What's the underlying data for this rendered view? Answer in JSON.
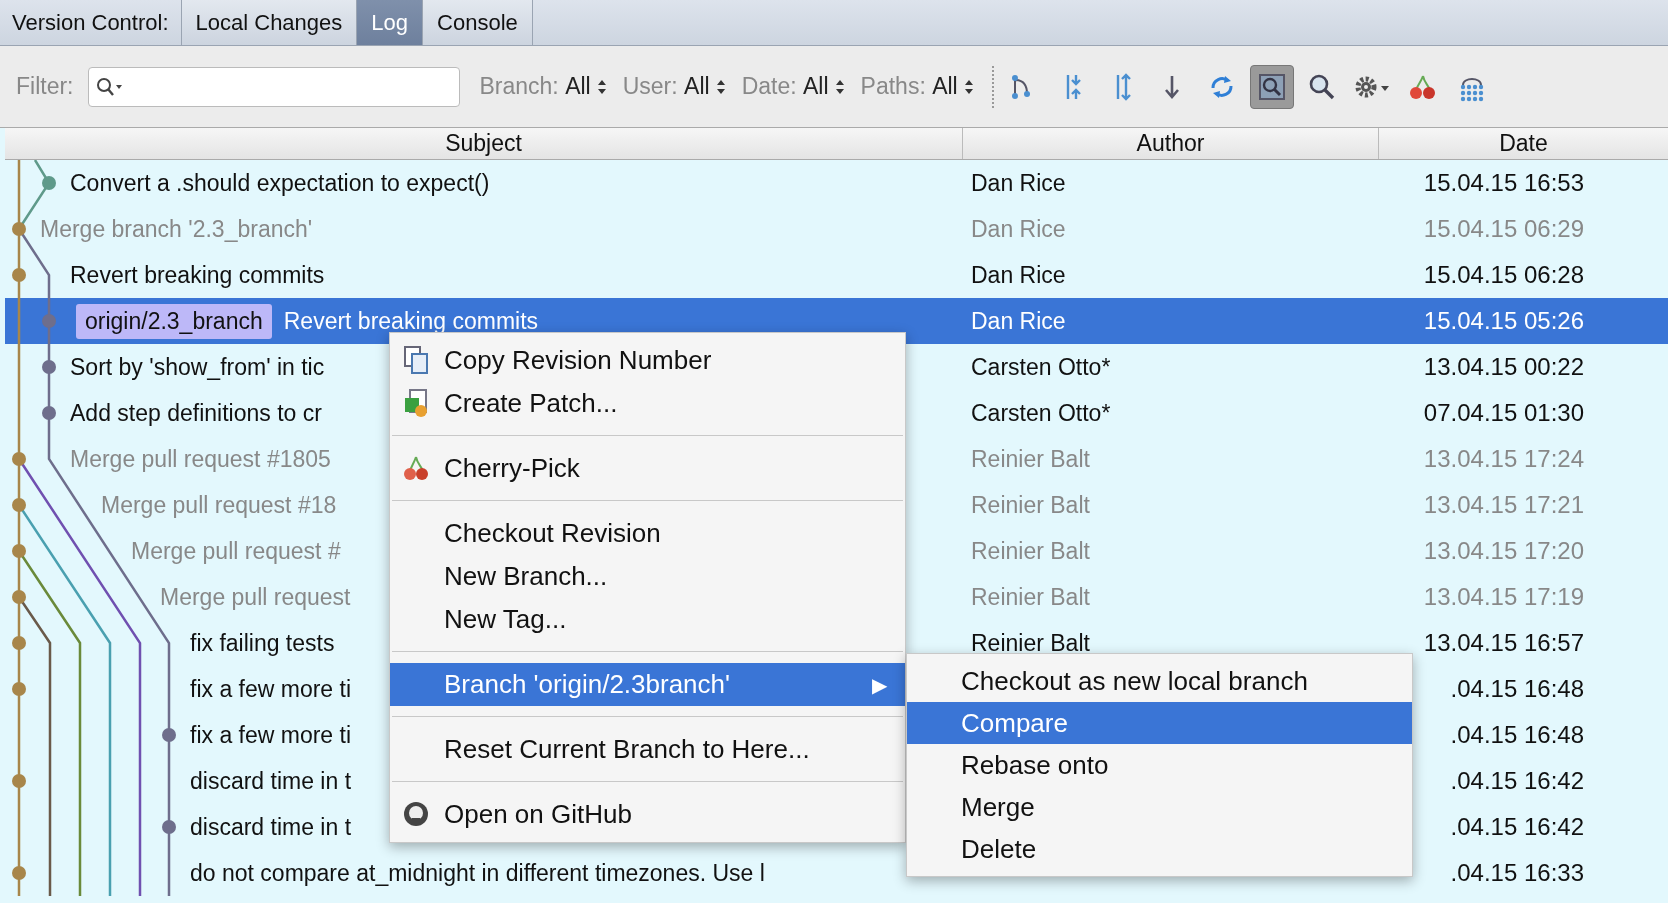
{
  "tab_bar": {
    "label": "Version Control:",
    "tabs": [
      {
        "label": "Local Changes",
        "selected": false
      },
      {
        "label": "Log",
        "selected": true
      },
      {
        "label": "Console",
        "selected": false
      }
    ]
  },
  "filter_bar": {
    "filter_label": "Filter:",
    "dropdowns": [
      {
        "label": "Branch:",
        "value": "All"
      },
      {
        "label": "User:",
        "value": "All"
      },
      {
        "label": "Date:",
        "value": "All"
      },
      {
        "label": "Paths:",
        "value": "All"
      }
    ],
    "tool_buttons": [
      {
        "on": false
      },
      {
        "on": false
      },
      {
        "on": false
      },
      {
        "on": false
      },
      {
        "on": false
      },
      {
        "on": true
      },
      {
        "on": false
      },
      {
        "on": false
      },
      {
        "on": false
      },
      {
        "on": false
      }
    ]
  },
  "table": {
    "columns": [
      "Subject",
      "Author",
      "Date"
    ],
    "rows": [
      {
        "subject": "Convert a .should expectation to expect()",
        "author": "Dan Rice",
        "date": "15.04.15 16:53",
        "muted": false,
        "selected": false
      },
      {
        "subject": "Merge branch '2.3_branch'",
        "author": "Dan Rice",
        "date": "15.04.15 06:29",
        "muted": true,
        "selected": false
      },
      {
        "subject": "Revert breaking commits",
        "author": "Dan Rice",
        "date": "15.04.15 06:28",
        "muted": false,
        "selected": false
      },
      {
        "tag": "origin/2.3_branch",
        "subject": "Revert breaking commits",
        "author": "Dan Rice",
        "date": "15.04.15 05:26",
        "muted": false,
        "selected": true
      },
      {
        "subject": "Sort by 'show_from' in tic",
        "author": "Carsten Otto*",
        "date": "13.04.15 00:22",
        "muted": false,
        "selected": false
      },
      {
        "subject": "Add step definitions to cr",
        "author": "Carsten Otto*",
        "date": "07.04.15 01:30",
        "muted": false,
        "selected": false
      },
      {
        "subject": "Merge pull request #1805",
        "author": "Reinier Balt",
        "date": "13.04.15 17:24",
        "muted": true,
        "selected": false
      },
      {
        "subject": "Merge pull request #18",
        "author": "Reinier Balt",
        "date": "13.04.15 17:21",
        "muted": true,
        "selected": false
      },
      {
        "subject": "Merge pull request #",
        "author": "Reinier Balt",
        "date": "13.04.15 17:20",
        "muted": true,
        "selected": false
      },
      {
        "subject": "Merge pull request",
        "author": "Reinier Balt",
        "date": "13.04.15 17:19",
        "muted": true,
        "selected": false
      },
      {
        "subject": "fix failing tests",
        "author": "Reinier Balt",
        "date": "13.04.15 16:57",
        "muted": false,
        "selected": false
      },
      {
        "subject": "fix a few more ti",
        "date": ".04.15 16:48",
        "muted": false,
        "selected": false
      },
      {
        "subject": "fix a few more ti",
        "date": ".04.15 16:48",
        "muted": false,
        "selected": false
      },
      {
        "subject": "discard time in t",
        "date": ".04.15 16:42",
        "muted": false,
        "selected": false
      },
      {
        "subject": "discard time in t",
        "date": ".04.15 16:42",
        "muted": false,
        "selected": false
      },
      {
        "subject": "do not compare at_midnight in different timezones. Use l",
        "date": ".04.15 16:33",
        "muted": false,
        "selected": false
      }
    ]
  },
  "context_menu": {
    "items": [
      {
        "kind": "item",
        "label": "Copy Revision Number",
        "selected": false
      },
      {
        "kind": "item",
        "label": "Create Patch...",
        "selected": false
      },
      {
        "kind": "separator"
      },
      {
        "kind": "item",
        "label": "Cherry-Pick",
        "selected": false
      },
      {
        "kind": "separator"
      },
      {
        "kind": "item",
        "label": "Checkout Revision",
        "selected": false
      },
      {
        "kind": "item",
        "label": "New Branch...",
        "selected": false
      },
      {
        "kind": "item",
        "label": "New Tag...",
        "selected": false
      },
      {
        "kind": "separator"
      },
      {
        "kind": "submenu",
        "label": "Branch 'origin/2.3branch'",
        "arrow": "▶",
        "selected": true
      },
      {
        "kind": "separator"
      },
      {
        "kind": "item",
        "label": "Reset Current Branch to Here...",
        "selected": false
      },
      {
        "kind": "separator"
      },
      {
        "kind": "item",
        "label": "Open on GitHub",
        "selected": false
      }
    ]
  },
  "submenu": {
    "items": [
      {
        "label": "Checkout as new local branch",
        "selected": false
      },
      {
        "label": "Compare",
        "selected": true
      },
      {
        "label": "Rebase onto",
        "selected": false
      },
      {
        "label": "Merge",
        "selected": false
      },
      {
        "label": "Delete",
        "selected": false
      }
    ]
  }
}
